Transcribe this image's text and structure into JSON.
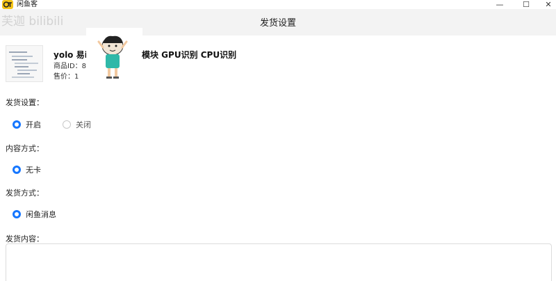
{
  "window": {
    "app_title": "闲鱼客",
    "watermark": "芙迦 bilibili",
    "minimize_glyph": "—",
    "maximize_glyph": "☐",
    "close_glyph": "✕"
  },
  "header": {
    "title": "发货设置"
  },
  "product": {
    "name": "yolo 易i",
    "name_tail": "模块 GPU识别 CPU识别",
    "id_label": "商品ID：8",
    "price_label": "售价：1"
  },
  "form": {
    "delivery_setting": {
      "label": "发货设置：",
      "options": [
        {
          "label": "开启",
          "checked": true
        },
        {
          "label": "关闭",
          "checked": false
        }
      ]
    },
    "content_mode": {
      "label": "内容方式：",
      "options": [
        {
          "label": "无卡",
          "checked": true
        }
      ]
    },
    "delivery_method": {
      "label": "发货方式：",
      "options": [
        {
          "label": "闲鱼消息",
          "checked": true
        }
      ]
    },
    "delivery_content": {
      "label": "发货内容：",
      "value": ""
    }
  },
  "colors": {
    "accent": "#1677ff",
    "header_bg": "#f3f3f3",
    "logo": "#f5c518"
  }
}
